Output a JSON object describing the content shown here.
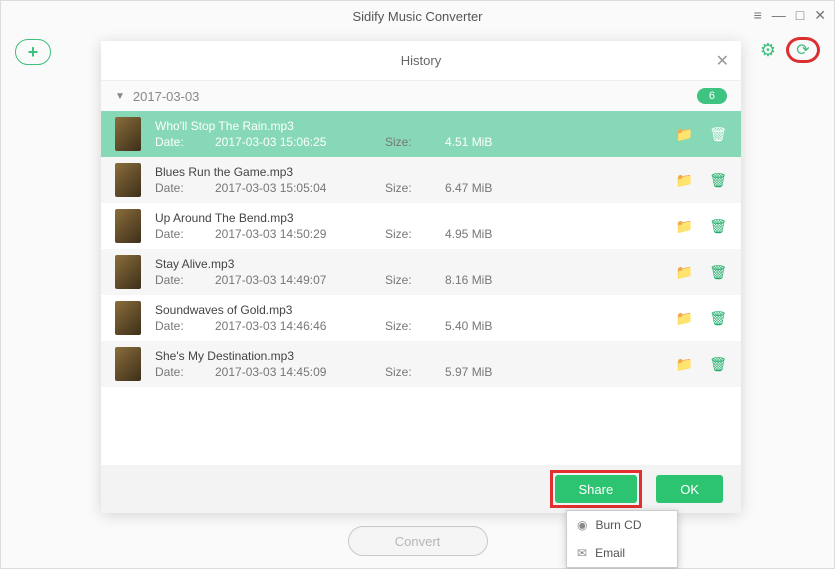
{
  "app": {
    "title": "Sidify Music Converter"
  },
  "toolbar": {
    "add_label": "+"
  },
  "history": {
    "title": "History",
    "group_date": "2017-03-03",
    "group_count": "6",
    "date_label": "Date:",
    "size_label": "Size:",
    "items": [
      {
        "name": "Who'll Stop The Rain.mp3",
        "date": "2017-03-03 15:06:25",
        "size": "4.51 MiB",
        "selected": true
      },
      {
        "name": "Blues Run the Game.mp3",
        "date": "2017-03-03 15:05:04",
        "size": "6.47 MiB",
        "selected": false
      },
      {
        "name": "Up Around The Bend.mp3",
        "date": "2017-03-03 14:50:29",
        "size": "4.95 MiB",
        "selected": false
      },
      {
        "name": "Stay Alive.mp3",
        "date": "2017-03-03 14:49:07",
        "size": "8.16 MiB",
        "selected": false
      },
      {
        "name": "Soundwaves of Gold.mp3",
        "date": "2017-03-03 14:46:46",
        "size": "5.40 MiB",
        "selected": false
      },
      {
        "name": "She's My Destination.mp3",
        "date": "2017-03-03 14:45:09",
        "size": "5.97 MiB",
        "selected": false
      }
    ],
    "share_label": "Share",
    "ok_label": "OK",
    "share_menu": {
      "burn": "Burn CD",
      "email": "Email"
    }
  },
  "main": {
    "convert_label": "Convert"
  }
}
